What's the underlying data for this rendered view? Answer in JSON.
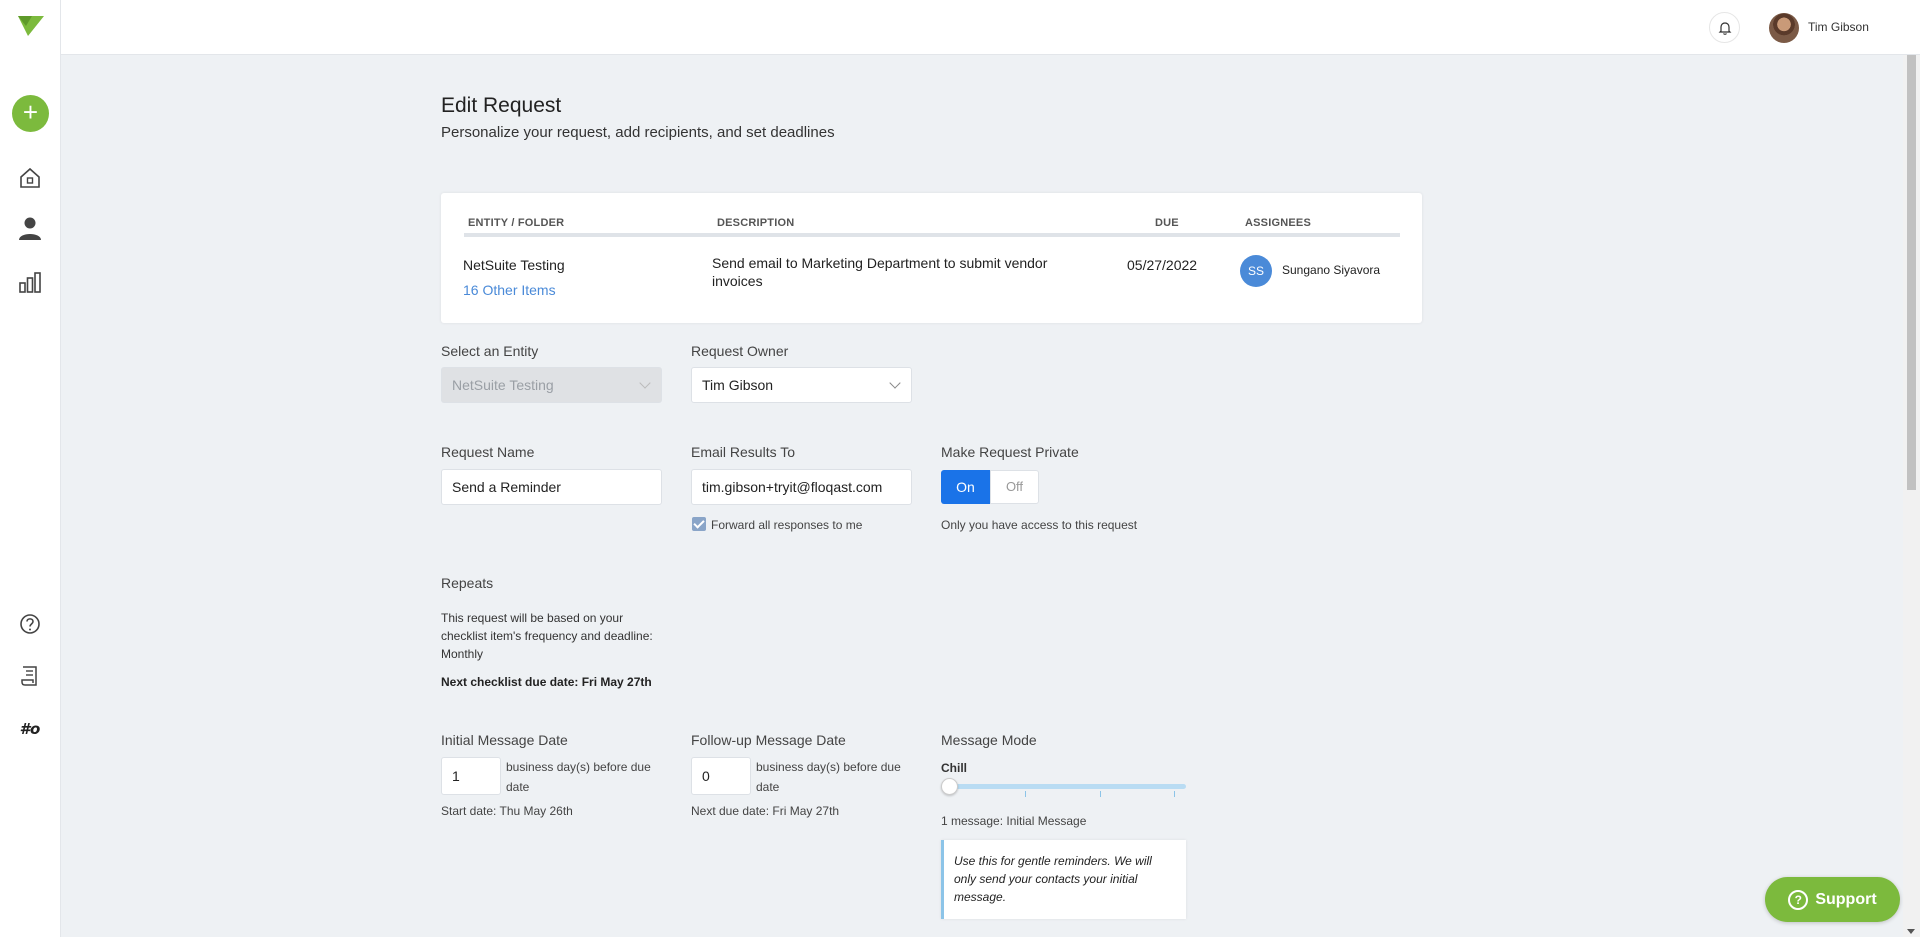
{
  "topbar": {
    "user_name": "Tim Gibson"
  },
  "page": {
    "title": "Edit Request",
    "subtitle": "Personalize your request, add recipients, and set deadlines"
  },
  "table": {
    "headers": {
      "entity": "ENTITY / FOLDER",
      "description": "DESCRIPTION",
      "due": "DUE",
      "assignees": "ASSIGNEES"
    },
    "row": {
      "entity": "NetSuite Testing",
      "other_items": "16 Other Items",
      "description_line1": "Send email to Marketing Department to submit vendor",
      "description_line2": "invoices",
      "due": "05/27/2022",
      "assignee_initials": "SS",
      "assignee_name": "Sungano Siyavora"
    }
  },
  "form": {
    "entity_label": "Select an Entity",
    "entity_value": "NetSuite Testing",
    "owner_label": "Request Owner",
    "owner_value": "Tim Gibson",
    "name_label": "Request Name",
    "name_value": "Send a Reminder",
    "email_label": "Email Results To",
    "email_value": "tim.gibson+tryit@floqast.com",
    "forward_label": "Forward all responses to me",
    "forward_checked": true,
    "private_label": "Make Request Private",
    "private_on": "On",
    "private_off": "Off",
    "private_note": "Only you have access to this request",
    "repeats_label": "Repeats",
    "repeats_text": "This request will be based on your checklist item's frequency and deadline: Monthly",
    "next_due": "Next checklist due date: Fri May 27th",
    "initial_label": "Initial Message Date",
    "initial_value": "1",
    "initial_suffix": "business day(s) before due date",
    "initial_start": "Start date: Thu May 26th",
    "followup_label": "Follow-up Message Date",
    "followup_value": "0",
    "followup_suffix": "business day(s) before due date",
    "followup_next": "Next due date: Fri May 27th",
    "mode_label": "Message Mode",
    "mode_value": "Chill",
    "mode_count": "1 message: Initial Message",
    "mode_info": "Use this for gentle reminders. We will only send your contacts your initial message."
  },
  "support": {
    "label": "Support"
  },
  "colors": {
    "accent_green": "#7cba3d",
    "primary_blue": "#1a73e8",
    "link_blue": "#4a8ad8"
  },
  "icons": [
    "logo-icon",
    "add-icon",
    "home-icon",
    "person-icon",
    "chart-icon",
    "help-icon",
    "notes-icon",
    "hashtag-icon",
    "bell-icon",
    "question-icon"
  ]
}
